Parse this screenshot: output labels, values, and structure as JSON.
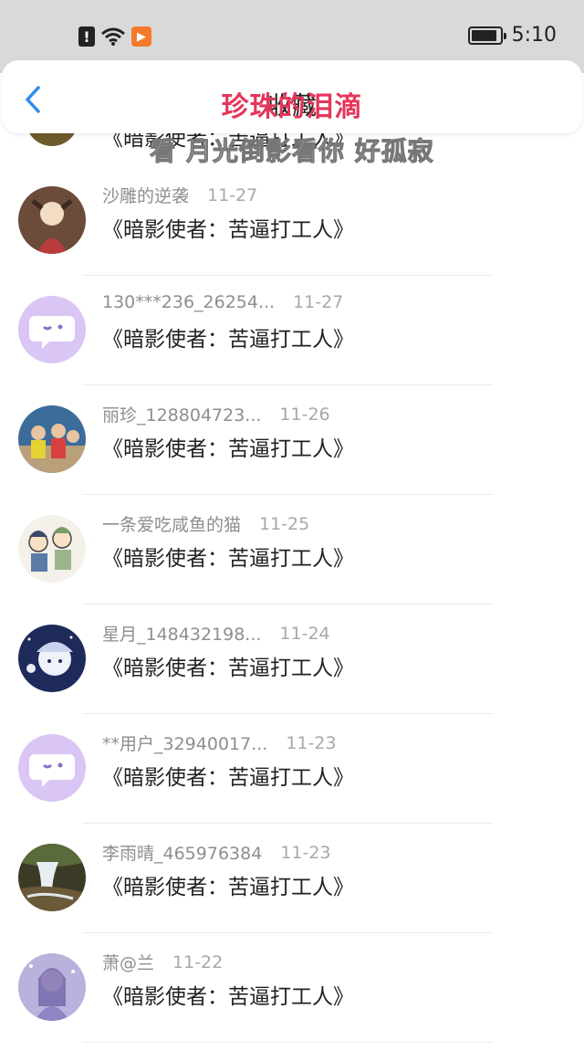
{
  "status_bar": {
    "alert_glyph": "!",
    "time": "5:10",
    "battery_level": 0.9
  },
  "nav": {
    "title": "收藏",
    "back_icon": "chevron-left-icon"
  },
  "video_overlay": {
    "red_caption": "珍珠的泪滴",
    "white_caption": "看 月光倒影看你 好孤寂"
  },
  "partial_row": {
    "content": "《暗影使者：苦逼打工人》"
  },
  "items": [
    {
      "name": "沙雕的逆袭",
      "date": "11-27",
      "content": "《暗影使者：苦逼打工人》",
      "avatar": "photo-red"
    },
    {
      "name": "130***236_26254...",
      "date": "11-27",
      "content": "《暗影使者：苦逼打工人》",
      "avatar": "default-chat"
    },
    {
      "name": "丽珍_128804723...",
      "date": "11-26",
      "content": "《暗影使者：苦逼打工人》",
      "avatar": "photo-kids"
    },
    {
      "name": "一条爱吃咸鱼的猫",
      "date": "11-25",
      "content": "《暗影使者：苦逼打工人》",
      "avatar": "photo-anime"
    },
    {
      "name": "星月_148432198...",
      "date": "11-24",
      "content": "《暗影使者：苦逼打工人》",
      "avatar": "photo-night"
    },
    {
      "name": "**用户_32940017...",
      "date": "11-23",
      "content": "《暗影使者：苦逼打工人》",
      "avatar": "default-chat"
    },
    {
      "name": "李雨晴_465976384",
      "date": "11-23",
      "content": "《暗影使者：苦逼打工人》",
      "avatar": "photo-waterfall"
    },
    {
      "name": "萧@兰",
      "date": "11-22",
      "content": "《暗影使者：苦逼打工人》",
      "avatar": "photo-lavender"
    }
  ]
}
